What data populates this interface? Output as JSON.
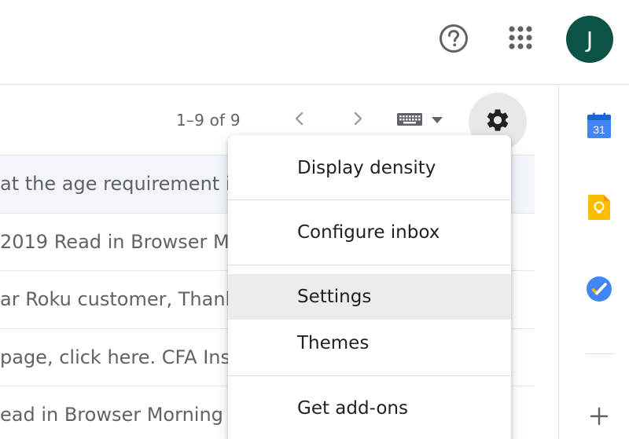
{
  "header": {
    "help_icon": "help-circle-icon",
    "apps_icon": "apps-grid-icon",
    "avatar_letter": "J",
    "avatar_color": "#0b5346"
  },
  "toolbar": {
    "count_text": "1–9 of 9",
    "prev_icon": "chevron-left-icon",
    "next_icon": "chevron-right-icon",
    "keyboard_icon": "keyboard-icon",
    "dropdown_icon": "caret-down-icon",
    "settings_icon": "gear-icon"
  },
  "emails": [
    {
      "snippet": "at the age requirement is"
    },
    {
      "snippet": " 2019 Read in Browser M"
    },
    {
      "snippet": "ar Roku customer, Thank"
    },
    {
      "snippet": "page, click here. CFA Inst"
    },
    {
      "snippet": "ead in Browser Morning E"
    }
  ],
  "settings_menu": {
    "items": [
      {
        "label": "Display density"
      },
      {
        "label": "Configure inbox"
      },
      {
        "label": "Settings",
        "active": true
      },
      {
        "label": "Themes"
      },
      {
        "label": "Get add-ons"
      }
    ]
  },
  "side_panel": {
    "calendar_day": "31",
    "calendar_icon": "calendar-icon",
    "keep_icon": "keep-icon",
    "tasks_icon": "tasks-icon",
    "add_icon": "plus-icon"
  },
  "colors": {
    "accent_blue": "#4285f4",
    "keep_yellow": "#fbbc04",
    "gear_hover": "#e8e8e8"
  }
}
